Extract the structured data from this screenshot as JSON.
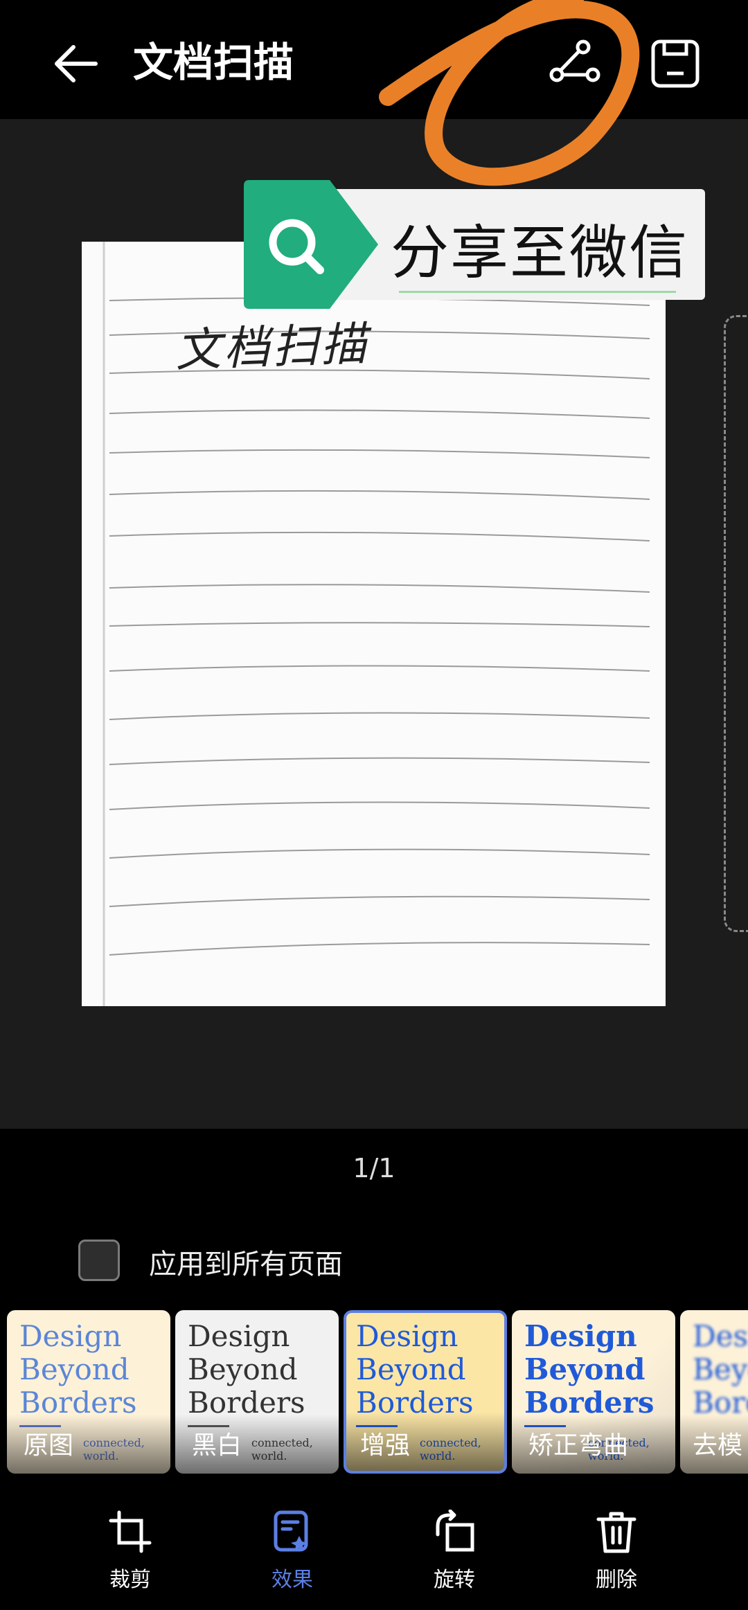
{
  "header": {
    "title": "文档扫描"
  },
  "document": {
    "handwriting": "文档扫描"
  },
  "tooltip": {
    "text": "分享至微信"
  },
  "pager": {
    "text": "1/1"
  },
  "apply_all": {
    "label": "应用到所有页面",
    "checked": false
  },
  "effects": {
    "preview_text": "Design Beyond Borders",
    "items": [
      {
        "label": "原图"
      },
      {
        "label": "黑白"
      },
      {
        "label": "增强",
        "selected": true
      },
      {
        "label": "矫正弯曲"
      },
      {
        "label": "去模"
      }
    ]
  },
  "nav": {
    "items": [
      {
        "label": "裁剪",
        "icon": "crop-icon"
      },
      {
        "label": "效果",
        "icon": "effects-icon",
        "active": true
      },
      {
        "label": "旋转",
        "icon": "rotate-icon"
      },
      {
        "label": "删除",
        "icon": "trash-icon"
      }
    ]
  },
  "colors": {
    "accent": "#5b7fe3",
    "tooltip_green": "#21ad7e",
    "scribble_orange": "#f5872a"
  }
}
